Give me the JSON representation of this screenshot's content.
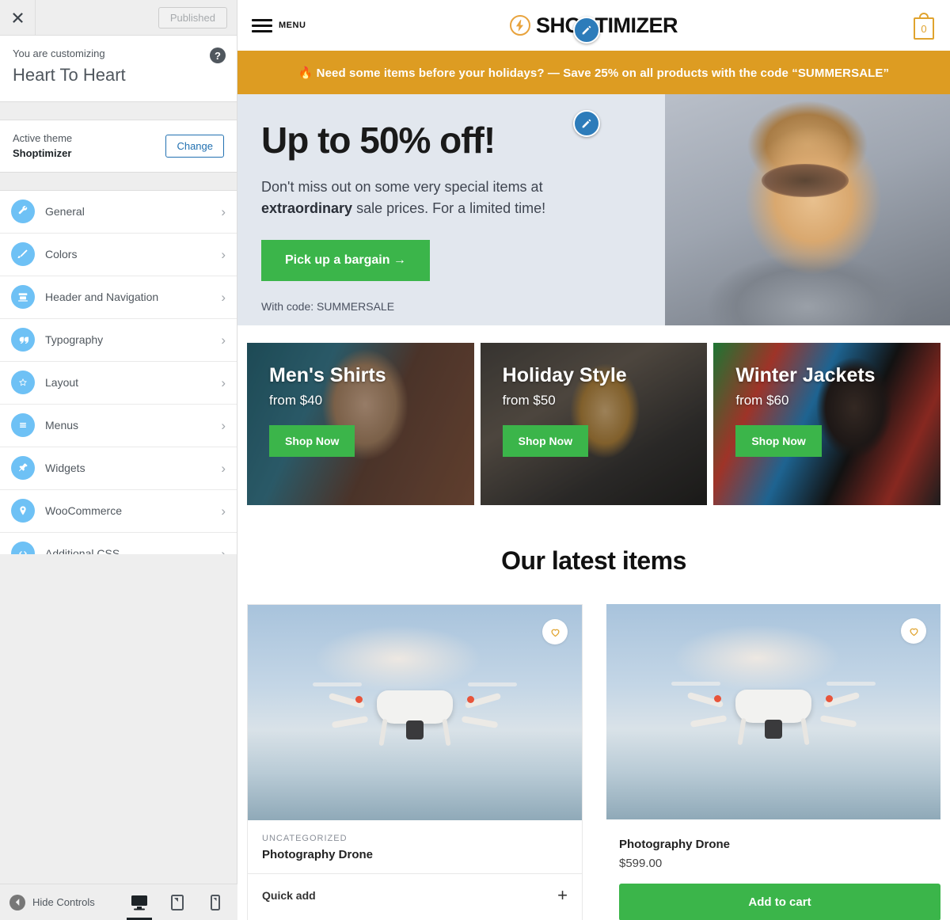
{
  "customizer": {
    "close_icon": "close-icon",
    "publish_label": "Published",
    "customizing_label": "You are customizing",
    "site_title": "Heart To Heart",
    "help_icon": "help-icon",
    "active_theme_label": "Active theme",
    "active_theme_name": "Shoptimizer",
    "change_label": "Change",
    "sections": [
      {
        "label": "General",
        "icon": "wrench-icon",
        "arrow": "›"
      },
      {
        "label": "Colors",
        "icon": "paintbrush-icon",
        "arrow": "›"
      },
      {
        "label": "Header and Navigation",
        "icon": "header-icon",
        "arrow": "›"
      },
      {
        "label": "Typography",
        "icon": "quote-icon",
        "arrow": "›"
      },
      {
        "label": "Layout",
        "icon": "star-icon",
        "arrow": "›"
      },
      {
        "label": "Menus",
        "icon": "menu-lines-icon",
        "arrow": "›"
      },
      {
        "label": "Widgets",
        "icon": "pin-icon",
        "arrow": "›"
      },
      {
        "label": "WooCommerce",
        "icon": "location-pin-icon",
        "arrow": "›"
      },
      {
        "label": "Additional CSS",
        "icon": "code-icon",
        "arrow": "›"
      }
    ],
    "footer": {
      "hide_controls_label": "Hide Controls",
      "devices": [
        {
          "name": "desktop",
          "active": true
        },
        {
          "name": "tablet",
          "active": false
        },
        {
          "name": "mobile",
          "active": false
        }
      ]
    }
  },
  "preview": {
    "header": {
      "menu_label": "MENU",
      "logo_text": "SHOPTIMIZER",
      "cart_count": "0"
    },
    "promo": {
      "fire_emoji": "🔥",
      "text": "Need some items before your holidays? — Save 25% on all products with the code “SUMMERSALE”"
    },
    "hero": {
      "title": "Up to 50% off!",
      "subtitle_part1": "Don't miss out on some very special items at ",
      "subtitle_bold": "extraordinary",
      "subtitle_part2": " sale prices. For a limited time!",
      "cta_label": "Pick up a bargain →",
      "code_note": "With code: SUMMERSALE"
    },
    "categories": [
      {
        "title": "Men's Shirts",
        "price": "from $40",
        "button": "Shop Now"
      },
      {
        "title": "Holiday Style",
        "price": "from $50",
        "button": "Shop Now"
      },
      {
        "title": "Winter Jackets",
        "price": "from $60",
        "button": "Shop Now"
      }
    ],
    "latest": {
      "heading": "Our latest items",
      "products": [
        {
          "category": "UNCATEGORIZED",
          "name": "Photography Drone",
          "quick_add_label": "Quick add",
          "quick_add_plus": "+"
        },
        {
          "name": "Photography Drone",
          "price": "$599.00",
          "add_to_cart_label": "Add to cart"
        }
      ]
    }
  },
  "colors": {
    "promo_bar": "#DD9C22",
    "accent_green": "#3BB54A",
    "accent_orange": "#E0A32E",
    "hero_bg": "#e2e7ee",
    "customizer_icon_blue": "#6ec1f5",
    "edit_pin_blue": "#2d7cba"
  }
}
